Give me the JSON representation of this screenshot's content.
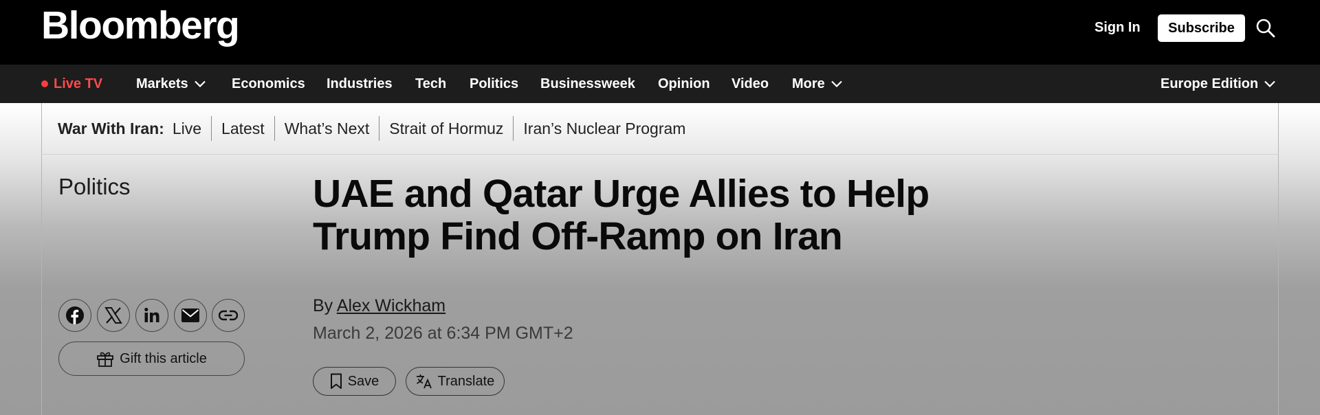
{
  "header": {
    "logo": "Bloomberg",
    "sign_in": "Sign In",
    "subscribe": "Subscribe"
  },
  "nav": {
    "live": "Live TV",
    "items": [
      "Markets",
      "Economics",
      "Industries",
      "Tech",
      "Politics",
      "Businessweek",
      "Opinion",
      "Video",
      "More"
    ],
    "edition": "Europe Edition"
  },
  "subnav": {
    "topic": "War With Iran:",
    "links": [
      "Live",
      "Latest",
      "What’s Next",
      "Strait of Hormuz",
      "Iran’s Nuclear Program"
    ]
  },
  "article": {
    "section": "Politics",
    "headline": "UAE and Qatar Urge Allies to Help Trump Find Off-Ramp on Iran",
    "by": "By",
    "author": "Alex Wickham",
    "date": "March 2, 2026 at 6:34 PM GMT+2"
  },
  "share": {
    "icons": [
      "facebook-icon",
      "x-icon",
      "linkedin-icon",
      "email-icon",
      "link-icon"
    ],
    "gift": "Gift this article"
  },
  "actions": {
    "save": "Save",
    "translate": "Translate"
  },
  "colors": {
    "live_accent": "#ff4b4b",
    "topbar": "#000000",
    "navbar": "#1d1d1d"
  }
}
